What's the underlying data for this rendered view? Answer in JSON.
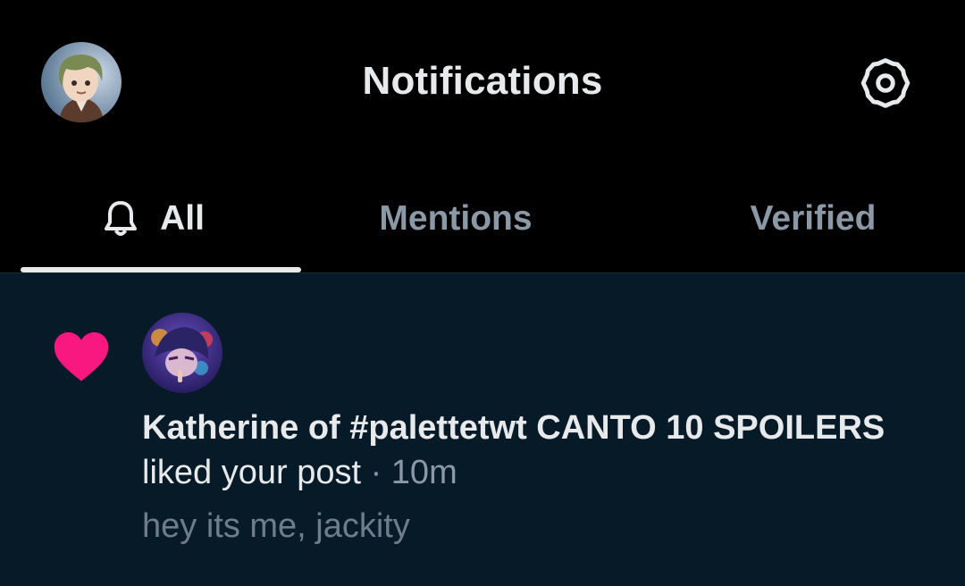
{
  "header": {
    "title": "Notifications",
    "avatar_icon": "user-avatar",
    "settings_icon": "gear-icon"
  },
  "tabs": [
    {
      "label": "All",
      "icon": "bell-icon",
      "active": true
    },
    {
      "label": "Mentions",
      "active": false
    },
    {
      "label": "Verified",
      "active": false
    }
  ],
  "notification": {
    "type_icon": "heart-icon",
    "type_color": "#f91880",
    "user_name": "Katherine of #palettetwt CANTO 10 SPOILERS",
    "action": "liked your post",
    "separator": "·",
    "time": "10m",
    "post_preview": "hey its me, jackity"
  },
  "colors": {
    "background": "#000000",
    "notification_background": "#071a28",
    "text_primary": "#e7e9ea",
    "text_secondary": "#8b98a5"
  }
}
